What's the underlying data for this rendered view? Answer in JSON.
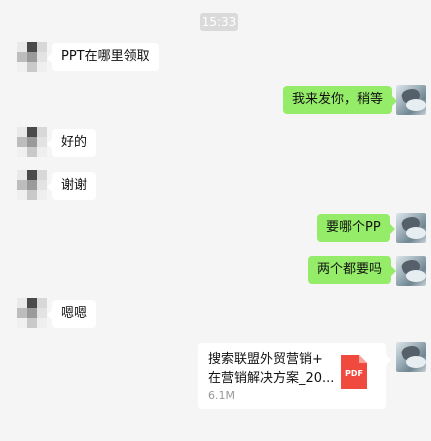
{
  "chat": {
    "timestamp": "15:33",
    "messages": [
      {
        "side": "left",
        "text": "PPT在哪里领取"
      },
      {
        "side": "right",
        "text": "我来发你，稍等"
      },
      {
        "side": "left",
        "text": "好的"
      },
      {
        "side": "left",
        "text": "谢谢"
      },
      {
        "side": "right",
        "text": "要哪个PP"
      },
      {
        "side": "right",
        "text": "两个都要吗"
      },
      {
        "side": "left",
        "text": "嗯嗯"
      }
    ],
    "file": {
      "name_line1": "搜索联盟外贸营销+",
      "name_line2": "在营销解决方案_20...",
      "size": "6.1M",
      "type_label": "PDF"
    }
  },
  "colors": {
    "background": "#f5f5f5",
    "bubble_right": "#95ec69",
    "bubble_left": "#ffffff",
    "pdf_icon": "#f04a3e"
  }
}
